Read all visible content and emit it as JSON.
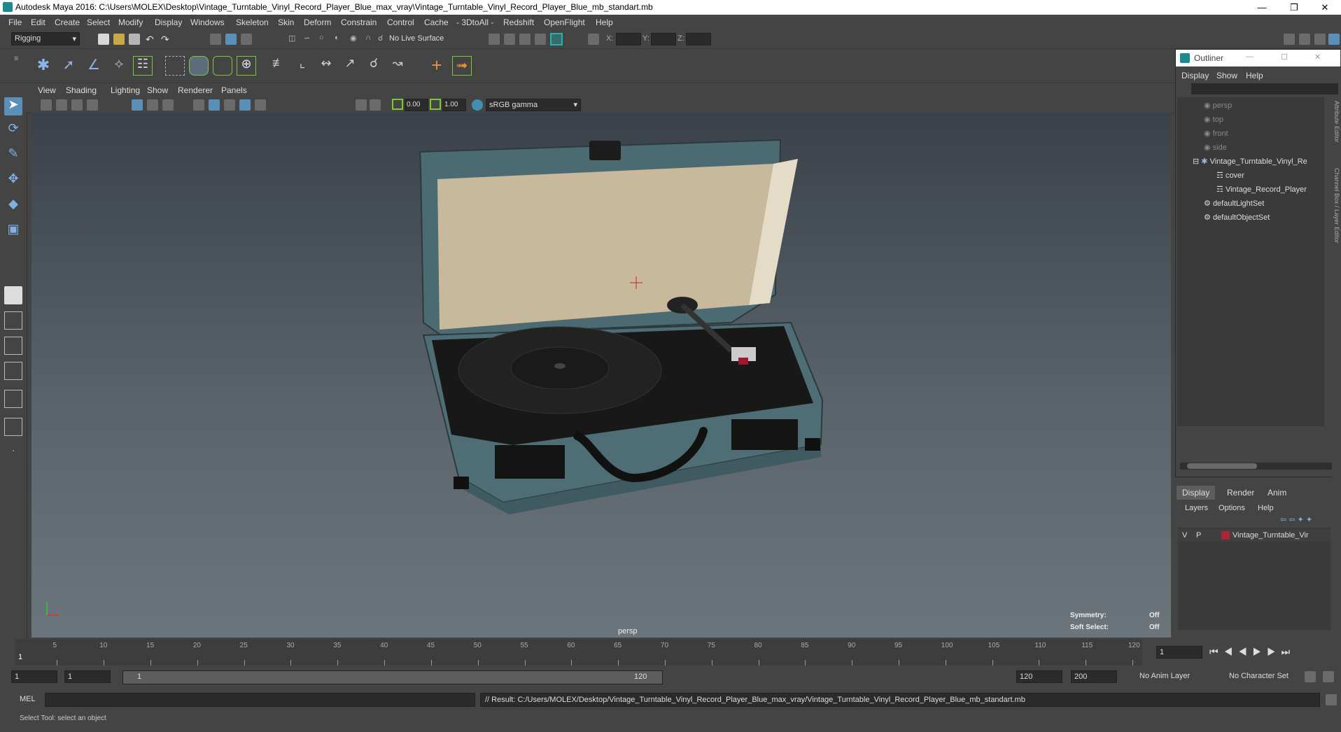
{
  "window": {
    "title": "Autodesk Maya 2016: C:\\Users\\MOLEX\\Desktop\\Vintage_Turntable_Vinyl_Record_Player_Blue_max_vray\\Vintage_Turntable_Vinyl_Record_Player_Blue_mb_standart.mb",
    "minimize": "—",
    "restore": "❐",
    "close": "✕"
  },
  "menubar": [
    "File",
    "Edit",
    "Create",
    "Select",
    "Modify",
    "Display",
    "Windows",
    "Skeleton",
    "Skin",
    "Deform",
    "Constrain",
    "Control",
    "Cache",
    "- 3DtoAll -",
    "Redshift",
    "OpenFlight",
    "Help"
  ],
  "statusline": {
    "mode": "Rigging",
    "live_surface": "No Live Surface",
    "x_label": "X:",
    "y_label": "Y:",
    "z_label": "Z:"
  },
  "panel_menu": [
    "View",
    "Shading",
    "Lighting",
    "Show",
    "Renderer",
    "Panels"
  ],
  "panel_toolbar": {
    "near": "0.00",
    "far": "1.00",
    "color_space": "sRGB gamma"
  },
  "viewport": {
    "camera": "persp",
    "symmetry_label": "Symmetry:",
    "symmetry_value": "Off",
    "soft_select_label": "Soft Select:",
    "soft_select_value": "Off",
    "body_color": "#4f6d74",
    "lid_color": "#c8b89c"
  },
  "timeline": {
    "ticks": [
      5,
      10,
      15,
      20,
      25,
      30,
      35,
      40,
      45,
      50,
      55,
      60,
      65,
      70,
      75,
      80,
      85,
      90,
      95,
      100,
      105,
      110,
      115,
      120
    ],
    "start_label": "1",
    "current_frame": "1"
  },
  "rangebar": {
    "start": "1",
    "playback_start": "1",
    "range_start": "1",
    "range_end": "120",
    "playback_end": "120",
    "end": "200",
    "anim_layer": "No Anim Layer",
    "character_set": "No Character Set"
  },
  "cmdline": {
    "lang": "MEL",
    "result": "// Result: C:/Users/MOLEX/Desktop/Vintage_Turntable_Vinyl_Record_Player_Blue_max_vray/Vintage_Turntable_Vinyl_Record_Player_Blue_mb_standart.mb"
  },
  "helpline": "Select Tool: select an object",
  "outliner": {
    "title": "Outliner",
    "menu": [
      "Display",
      "Show",
      "Help"
    ],
    "items": [
      {
        "label": "persp",
        "type": "camera",
        "indent": 1,
        "dim": true
      },
      {
        "label": "top",
        "type": "camera",
        "indent": 1,
        "dim": true
      },
      {
        "label": "front",
        "type": "camera",
        "indent": 1,
        "dim": true
      },
      {
        "label": "side",
        "type": "camera",
        "indent": 1,
        "dim": true
      },
      {
        "label": "Vintage_Turntable_Vinyl_Re",
        "type": "group",
        "indent": 0,
        "dim": false
      },
      {
        "label": "cover",
        "type": "mesh",
        "indent": 2,
        "dim": false
      },
      {
        "label": "Vintage_Record_Player",
        "type": "mesh",
        "indent": 2,
        "dim": false
      },
      {
        "label": "defaultLightSet",
        "type": "set",
        "indent": 1,
        "dim": false
      },
      {
        "label": "defaultObjectSet",
        "type": "set",
        "indent": 1,
        "dim": false
      }
    ]
  },
  "layer_editor": {
    "tabs": [
      "Display",
      "Render",
      "Anim"
    ],
    "menu": [
      "Layers",
      "Options",
      "Help"
    ],
    "layer": {
      "v": "V",
      "p": "P",
      "name": "Vintage_Turntable_Vir",
      "color": "#b0213a"
    }
  },
  "side_tabs": [
    "Attribute Editor",
    "Channel Box / Layer Editor"
  ]
}
